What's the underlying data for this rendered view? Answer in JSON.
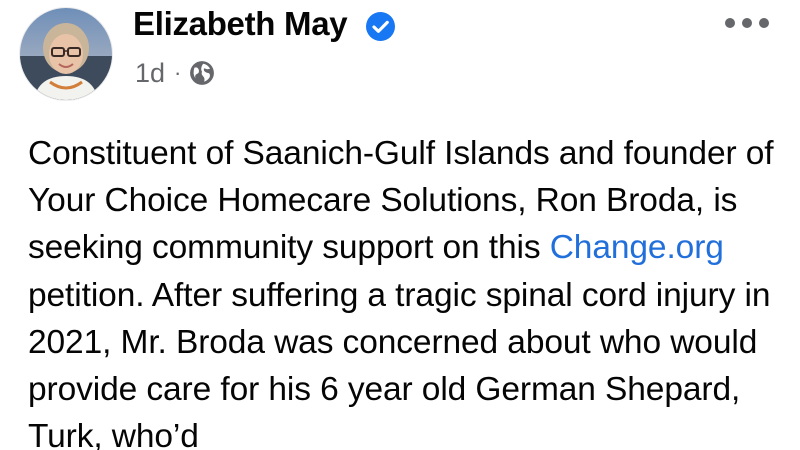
{
  "post": {
    "author": {
      "name": "Elizabeth May",
      "verified": true,
      "verified_badge_color": "#1877f2"
    },
    "timestamp": "1d",
    "separator": "·",
    "audience_icon": "globe-icon",
    "more_icon": "more-options-icon",
    "text": {
      "part1": "Constituent of Saanich-Gulf Islands and founder of Your Choice Homecare Solutions, Ron Broda, is seeking community support on this ",
      "link": "Change.org",
      "part2": " petition. After suffering a tragic spinal cord injury in 2021, Mr. Broda was concerned about who would provide care for his 6 year old German Shepard, Turk, who’d"
    },
    "colors": {
      "link": "#216fdb",
      "secondary_text": "#65676b",
      "primary_text": "#050505"
    }
  }
}
